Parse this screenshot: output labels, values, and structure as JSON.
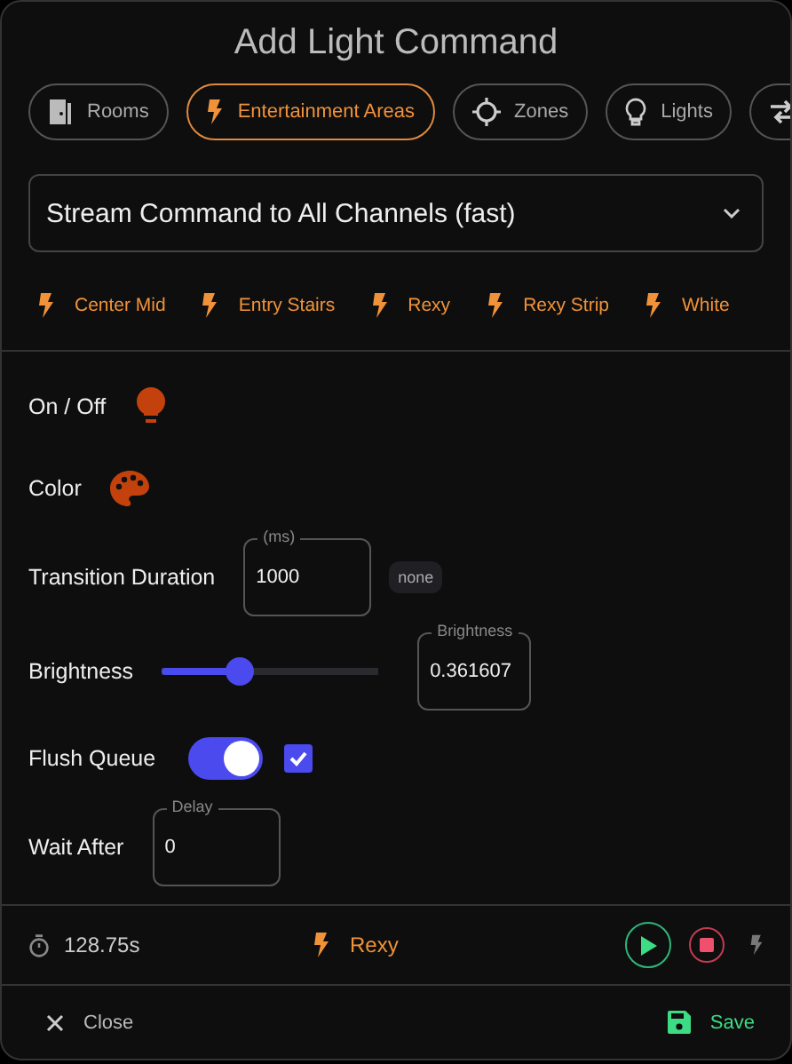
{
  "dialog": {
    "title": "Add Light Command"
  },
  "tabs": [
    {
      "label": "Rooms",
      "selected": false
    },
    {
      "label": "Entertainment Areas",
      "selected": true
    },
    {
      "label": "Zones",
      "selected": false
    },
    {
      "label": "Lights",
      "selected": false
    }
  ],
  "command_select": {
    "value": "Stream Command to All Channels (fast)"
  },
  "areas": [
    "Center Mid",
    "Entry Stairs",
    "Rexy",
    "Rexy Strip",
    "White"
  ],
  "settings": [
    {
      "kind": "icon",
      "label": "On / Off"
    },
    {
      "kind": "icon",
      "label": "Color"
    },
    {
      "kind": "field",
      "label": "Transition Duration",
      "field_label": "(ms)",
      "value": "1000",
      "chip": "none"
    },
    {
      "kind": "slider",
      "label": "Brightness",
      "level": 0.36,
      "field_label": "Brightness",
      "value": "0.361607"
    },
    {
      "kind": "toggle",
      "label": "Flush Queue",
      "on": true,
      "checked": true
    },
    {
      "kind": "field",
      "label": "Wait After",
      "field_label": "Delay",
      "value": "0"
    }
  ],
  "footer": {
    "duration": "128.75s",
    "target": "Rexy"
  },
  "actions": {
    "close": "Close",
    "save": "Save"
  }
}
